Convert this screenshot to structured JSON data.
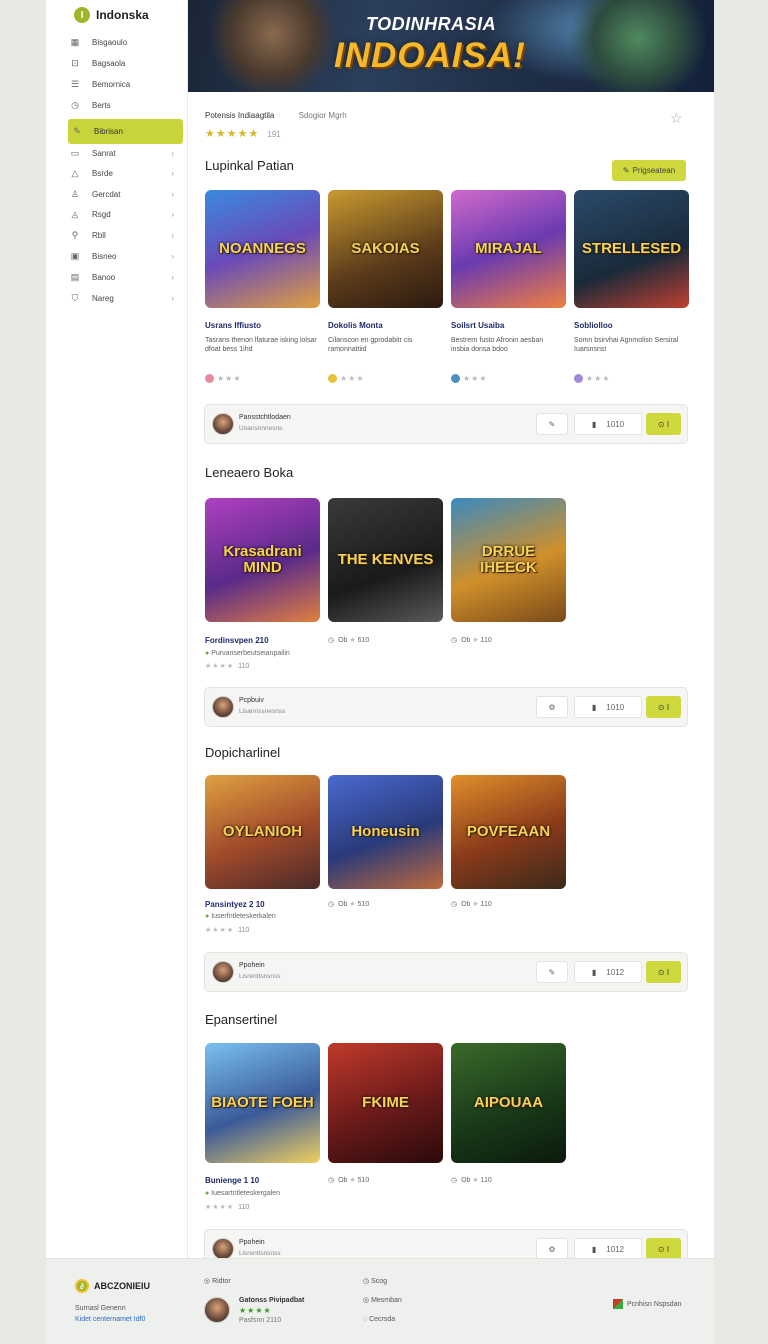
{
  "brand": {
    "logo_letter": "I",
    "name": "Indonska"
  },
  "sidebar": {
    "items": [
      {
        "icon": "grid-icon",
        "glyph": "▦",
        "label": "Bisgaoulo",
        "chevron": false
      },
      {
        "icon": "lock-icon",
        "glyph": "⊡",
        "label": "Bagsaola",
        "chevron": false
      },
      {
        "icon": "list-icon",
        "glyph": "☰",
        "label": "Bemornica",
        "chevron": false
      },
      {
        "icon": "clock-icon",
        "glyph": "◷",
        "label": "Berts",
        "chevron": false
      },
      {
        "icon": "pencil-icon",
        "glyph": "✎",
        "label": "Bibrisan",
        "chevron": false,
        "active": true
      },
      {
        "icon": "file-icon",
        "glyph": "▭",
        "label": "Sanrat",
        "chevron": true
      },
      {
        "icon": "bell-icon",
        "glyph": "△",
        "label": "Bsrde",
        "chevron": true
      },
      {
        "icon": "user-icon",
        "glyph": "♙",
        "label": "Gercdat",
        "chevron": true
      },
      {
        "icon": "shield-icon",
        "glyph": "◬",
        "label": "Rsgd",
        "chevron": true
      },
      {
        "icon": "person-icon",
        "glyph": "⚲",
        "label": "Rbll",
        "chevron": true
      },
      {
        "icon": "image-icon",
        "glyph": "▣",
        "label": "Bisneo",
        "chevron": true
      },
      {
        "icon": "archive-icon",
        "glyph": "▤",
        "label": "Banoo",
        "chevron": true
      },
      {
        "icon": "badge-icon",
        "glyph": "⛉",
        "label": "Nareg",
        "chevron": true
      }
    ]
  },
  "banner": {
    "line1": "TODINHRASIA",
    "line2": "INDOAISA!"
  },
  "header": {
    "title": "Potensis Indiaagtila",
    "subtitle": "Sdogior Mgrh",
    "stars": "★★★★★",
    "rating_count": "191"
  },
  "sections": [
    {
      "title": "Lupinkal Patian",
      "action_label": "Prigseatean",
      "cards": [
        {
          "image_title": "NOANNEGS",
          "title": "Usrans Iffiusto",
          "desc": "Tasrans thenon lfaturae isking lolsar dfoat bess 1ihd",
          "rating": "★★★",
          "dot_color": "#e58aa0"
        },
        {
          "image_title": "SAKOIAS",
          "title": "Dokolis Monta",
          "desc": "Cilanscon en gprodabitr cis ramonnattiid",
          "rating": "★★★",
          "dot_color": "#e6c23a"
        },
        {
          "image_title": "MIRAJAL",
          "title": "Soilsrt Usaiba",
          "desc": "Bestrern fusto Afronin aesban insbia donsa bdoo",
          "rating": "★★★",
          "dot_color": "#4a90c8"
        },
        {
          "image_title": "STRELLESED",
          "title": "Sobliolloo",
          "desc": "Somn bsirvhai Agnmolisn Sersiral Iuarsnsnst",
          "rating": "★★★",
          "dot_color": "#a08ad8"
        }
      ],
      "author": {
        "name": "Pansstchtlodaen",
        "sub": "Uoarisnnnesns",
        "count": "1010"
      }
    },
    {
      "title": "Leneaero Boka",
      "cards": [
        {
          "image_title": "Krasadrani MIND",
          "title": "Fordinsvpen 210",
          "meta": "Purvanserbeutseianpailin",
          "rating": "★★★★",
          "num": "110"
        },
        {
          "image_title": "THE KENVES",
          "meta_icon": "◷",
          "meta_text": "Ob",
          "meta_num": "610"
        },
        {
          "image_title": "DRRUE IHEECK",
          "meta_icon": "◷",
          "meta_text": "Ob",
          "meta_num": "110"
        }
      ],
      "author": {
        "name": "Pcpbuiv",
        "sub": "Lisannssnesnss",
        "count": "1010"
      }
    },
    {
      "title": "Dopicharlinel",
      "cards": [
        {
          "image_title": "OYLANIOH",
          "title": "Pansintyez 2 10",
          "meta": "Iuserfntleteskerkalen",
          "rating": "★★★★",
          "num": "110"
        },
        {
          "image_title": "Honeusin",
          "meta_icon": "◷",
          "meta_text": "Ob",
          "meta_num": "510"
        },
        {
          "image_title": "POVFEAAN",
          "meta_icon": "◷",
          "meta_text": "Ob",
          "meta_num": "110"
        }
      ],
      "author": {
        "name": "Ppohein",
        "sub": "Lisrenttsnsnss",
        "count": "1012"
      }
    },
    {
      "title": "Epansertinel",
      "cards": [
        {
          "image_title": "BIAOTE FOEH",
          "title": "Bunienge 1 10",
          "meta": "Iuesartntleteskergalen",
          "rating": "★★★★",
          "num": "110"
        },
        {
          "image_title": "FKIME",
          "meta_icon": "◷",
          "meta_text": "Ob",
          "meta_num": "510"
        },
        {
          "image_title": "AIPOUAA",
          "meta_icon": "◷",
          "meta_text": "Ob",
          "meta_num": "110"
        }
      ],
      "author": {
        "name": "Ppohein",
        "sub": "Lisrenttsnsnss",
        "count": "1012"
      }
    }
  ],
  "footer": {
    "brand": "ABCZONIEIU",
    "desc1": "Surnasl Genenn",
    "desc2": "Kidet centernamet Idf0",
    "link1": "Ridtor",
    "user_name": "Gatonss Pivipadbat",
    "user_stars": "★★★★",
    "user_meta": "Pasfsnn 2110",
    "links": [
      "Scog",
      "Mesmban",
      "Cecrsda"
    ],
    "partner": "Pcnhisn Nspsdan"
  }
}
